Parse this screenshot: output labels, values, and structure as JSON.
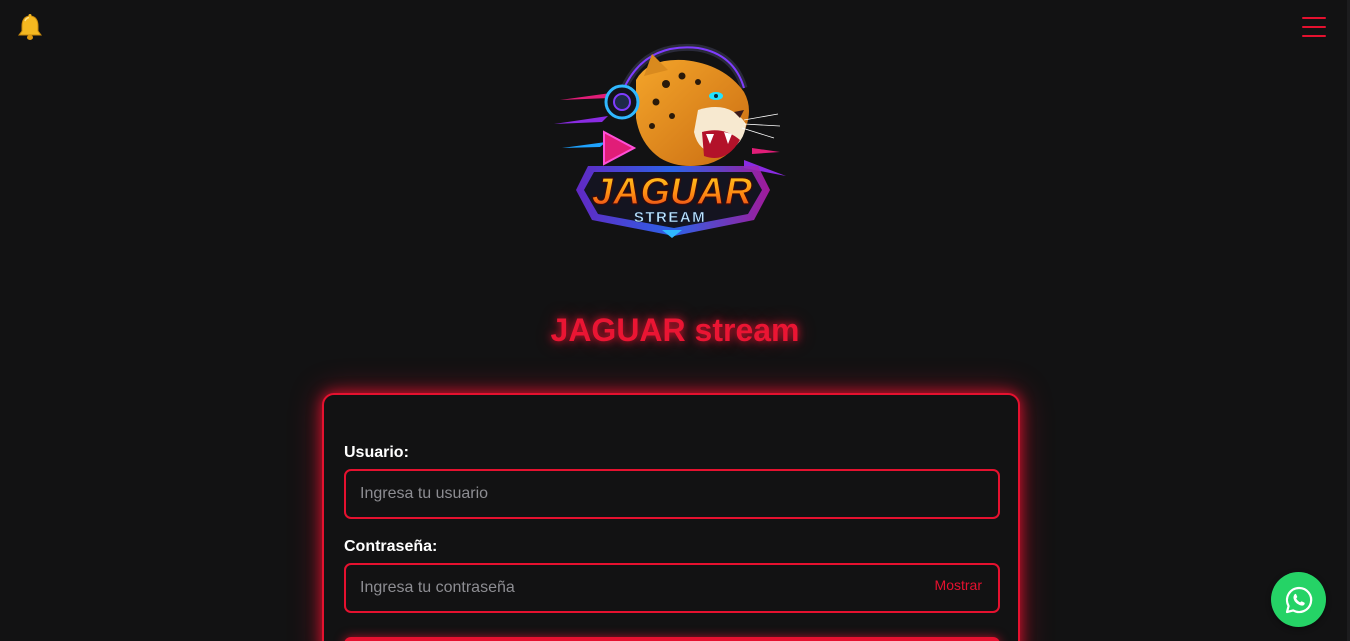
{
  "header": {
    "notification_icon": "bell-icon",
    "menu_icon": "hamburger-menu-icon"
  },
  "logo": {
    "icon": "jaguar-stream-logo",
    "wordmark_top": "JAGUAR",
    "wordmark_bottom": "STREAM"
  },
  "brand": {
    "title": "JAGUAR stream"
  },
  "login_form": {
    "username_label": "Usuario:",
    "username_placeholder": "Ingresa tu usuario",
    "username_value": "",
    "password_label": "Contraseña:",
    "password_placeholder": "Ingresa tu contraseña",
    "password_value": "",
    "show_password_label": "Mostrar"
  },
  "floating": {
    "whatsapp_icon": "whatsapp-icon"
  },
  "colors": {
    "background": "#121213",
    "accent": "#e5112f",
    "whatsapp": "#25d366"
  }
}
